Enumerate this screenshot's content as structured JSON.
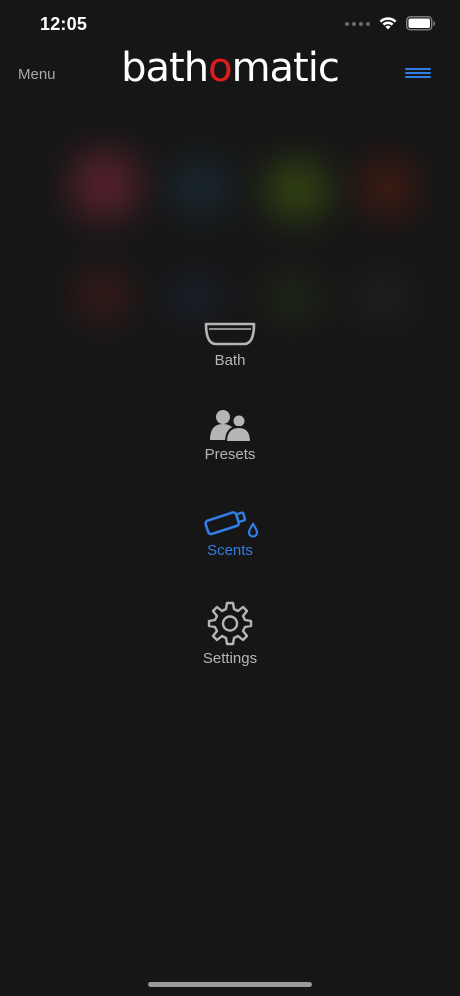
{
  "status_bar": {
    "time": "12:05"
  },
  "header": {
    "menu_label": "Menu",
    "logo": {
      "before": "bath",
      "accent": "o",
      "after": "matic"
    }
  },
  "nav": {
    "items": [
      {
        "label": "Bath",
        "icon": "bathtub-icon",
        "active": false
      },
      {
        "label": "Presets",
        "icon": "users-icon",
        "active": false
      },
      {
        "label": "Scents",
        "icon": "scent-bottle-icon",
        "active": true
      },
      {
        "label": "Settings",
        "icon": "gear-icon",
        "active": false
      }
    ]
  },
  "colors": {
    "background": "#161616",
    "accent": "#2f7fe6",
    "brand_red": "#e01b1b",
    "inactive": "#b5b5b5"
  }
}
